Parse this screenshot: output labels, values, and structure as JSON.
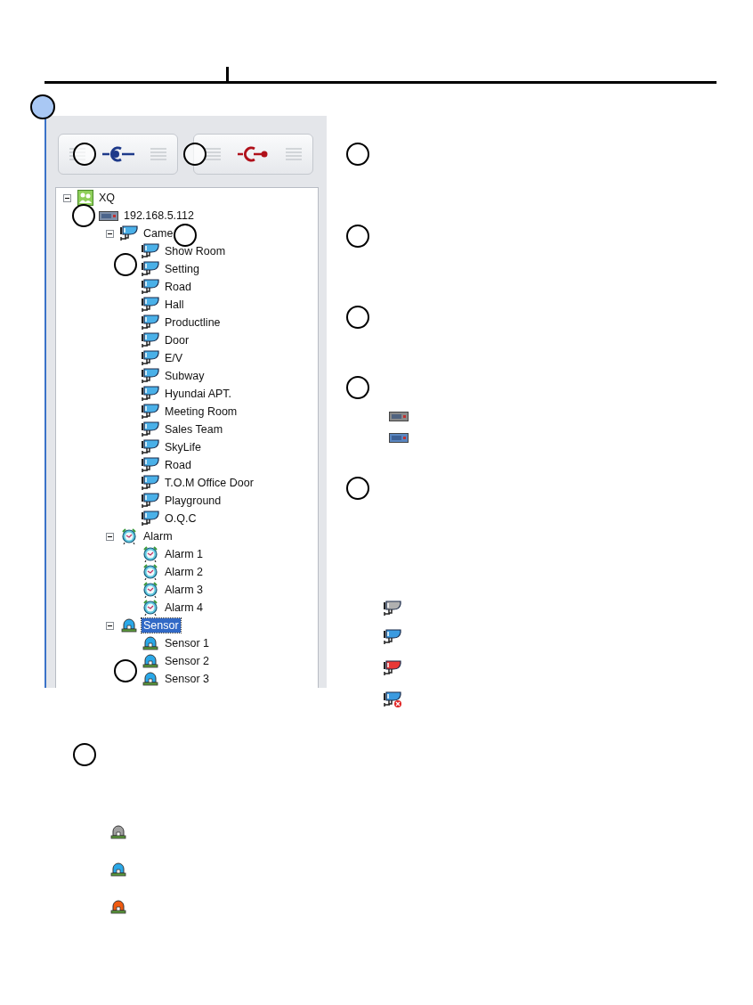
{
  "toolbar": {
    "buttons": [
      {
        "kind": "connect"
      },
      {
        "kind": "disconnect"
      }
    ]
  },
  "tree": [
    {
      "kind": "group",
      "label": "XQ",
      "expanded": true,
      "selected": false,
      "children": [
        {
          "kind": "device",
          "label": "192.168.5.112",
          "selected": false,
          "children": [
            {
              "kind": "camera",
              "label": "Came",
              "expanded": true,
              "selected": false,
              "children": [
                {
                  "kind": "camera",
                  "label": "Show Room",
                  "selected": false
                },
                {
                  "kind": "camera",
                  "label": "Setting",
                  "selected": false
                },
                {
                  "kind": "camera",
                  "label": "Road",
                  "selected": false
                },
                {
                  "kind": "camera",
                  "label": "Hall",
                  "selected": false
                },
                {
                  "kind": "camera",
                  "label": "Productline",
                  "selected": false
                },
                {
                  "kind": "camera",
                  "label": "Door",
                  "selected": false
                },
                {
                  "kind": "camera",
                  "label": "E/V",
                  "selected": false
                },
                {
                  "kind": "camera",
                  "label": "Subway",
                  "selected": false
                },
                {
                  "kind": "camera",
                  "label": "Hyundai APT.",
                  "selected": false
                },
                {
                  "kind": "camera",
                  "label": "Meeting Room",
                  "selected": false
                },
                {
                  "kind": "camera",
                  "label": "Sales Team",
                  "selected": false
                },
                {
                  "kind": "camera",
                  "label": "SkyLife",
                  "selected": false
                },
                {
                  "kind": "camera",
                  "label": "Road",
                  "selected": false
                },
                {
                  "kind": "camera",
                  "label": "T.O.M Office Door",
                  "selected": false
                },
                {
                  "kind": "camera",
                  "label": "Playground",
                  "selected": false
                },
                {
                  "kind": "camera",
                  "label": "O.Q.C",
                  "selected": false
                }
              ]
            },
            {
              "kind": "alarm",
              "label": "Alarm",
              "expanded": true,
              "selected": false,
              "children": [
                {
                  "kind": "alarm",
                  "label": "Alarm 1",
                  "selected": false
                },
                {
                  "kind": "alarm",
                  "label": "Alarm 2",
                  "selected": false
                },
                {
                  "kind": "alarm",
                  "label": "Alarm 3",
                  "selected": false
                },
                {
                  "kind": "alarm",
                  "label": "Alarm 4",
                  "selected": false
                }
              ]
            },
            {
              "kind": "sensor",
              "label": "Sensor",
              "expanded": true,
              "selected": true,
              "children": [
                {
                  "kind": "sensor",
                  "label": "Sensor 1",
                  "selected": false
                },
                {
                  "kind": "sensor",
                  "label": "Sensor 2",
                  "selected": false
                },
                {
                  "kind": "sensor",
                  "label": "Sensor 3",
                  "selected": false
                }
              ]
            }
          ]
        }
      ]
    }
  ],
  "device_legend": [
    {
      "color": "#8a8a8a"
    },
    {
      "color": "#5a86c0"
    }
  ],
  "camera_legend": [
    {
      "color": "#b0b0b0",
      "error": false
    },
    {
      "color": "#3a9ae0",
      "error": false
    },
    {
      "color": "#e83838",
      "error": false
    },
    {
      "color": "#3a9ae0",
      "error": true
    }
  ],
  "sensor_legend": [
    {
      "color": "#a0a0a0"
    },
    {
      "color": "#2aa8e8"
    },
    {
      "color": "#f05a10"
    }
  ]
}
